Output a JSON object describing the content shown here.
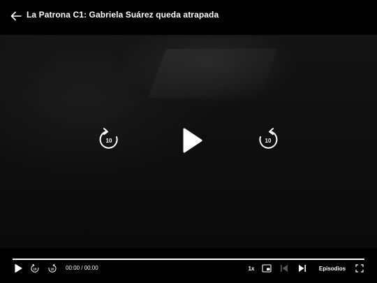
{
  "header": {
    "title": "La Patrona C1: Gabriela Suárez queda atrapada",
    "back_icon": "arrow-left-icon"
  },
  "center_controls": {
    "rewind_seconds": "10",
    "forward_seconds": "10"
  },
  "progress": {
    "fraction": 1.0
  },
  "bottom_bar": {
    "time": "00:00 / 00:00",
    "speed_label": "1x",
    "episodes_label": "Episodios"
  },
  "colors": {
    "background": "#000000",
    "foreground": "#ffffff",
    "track": "#555555"
  }
}
